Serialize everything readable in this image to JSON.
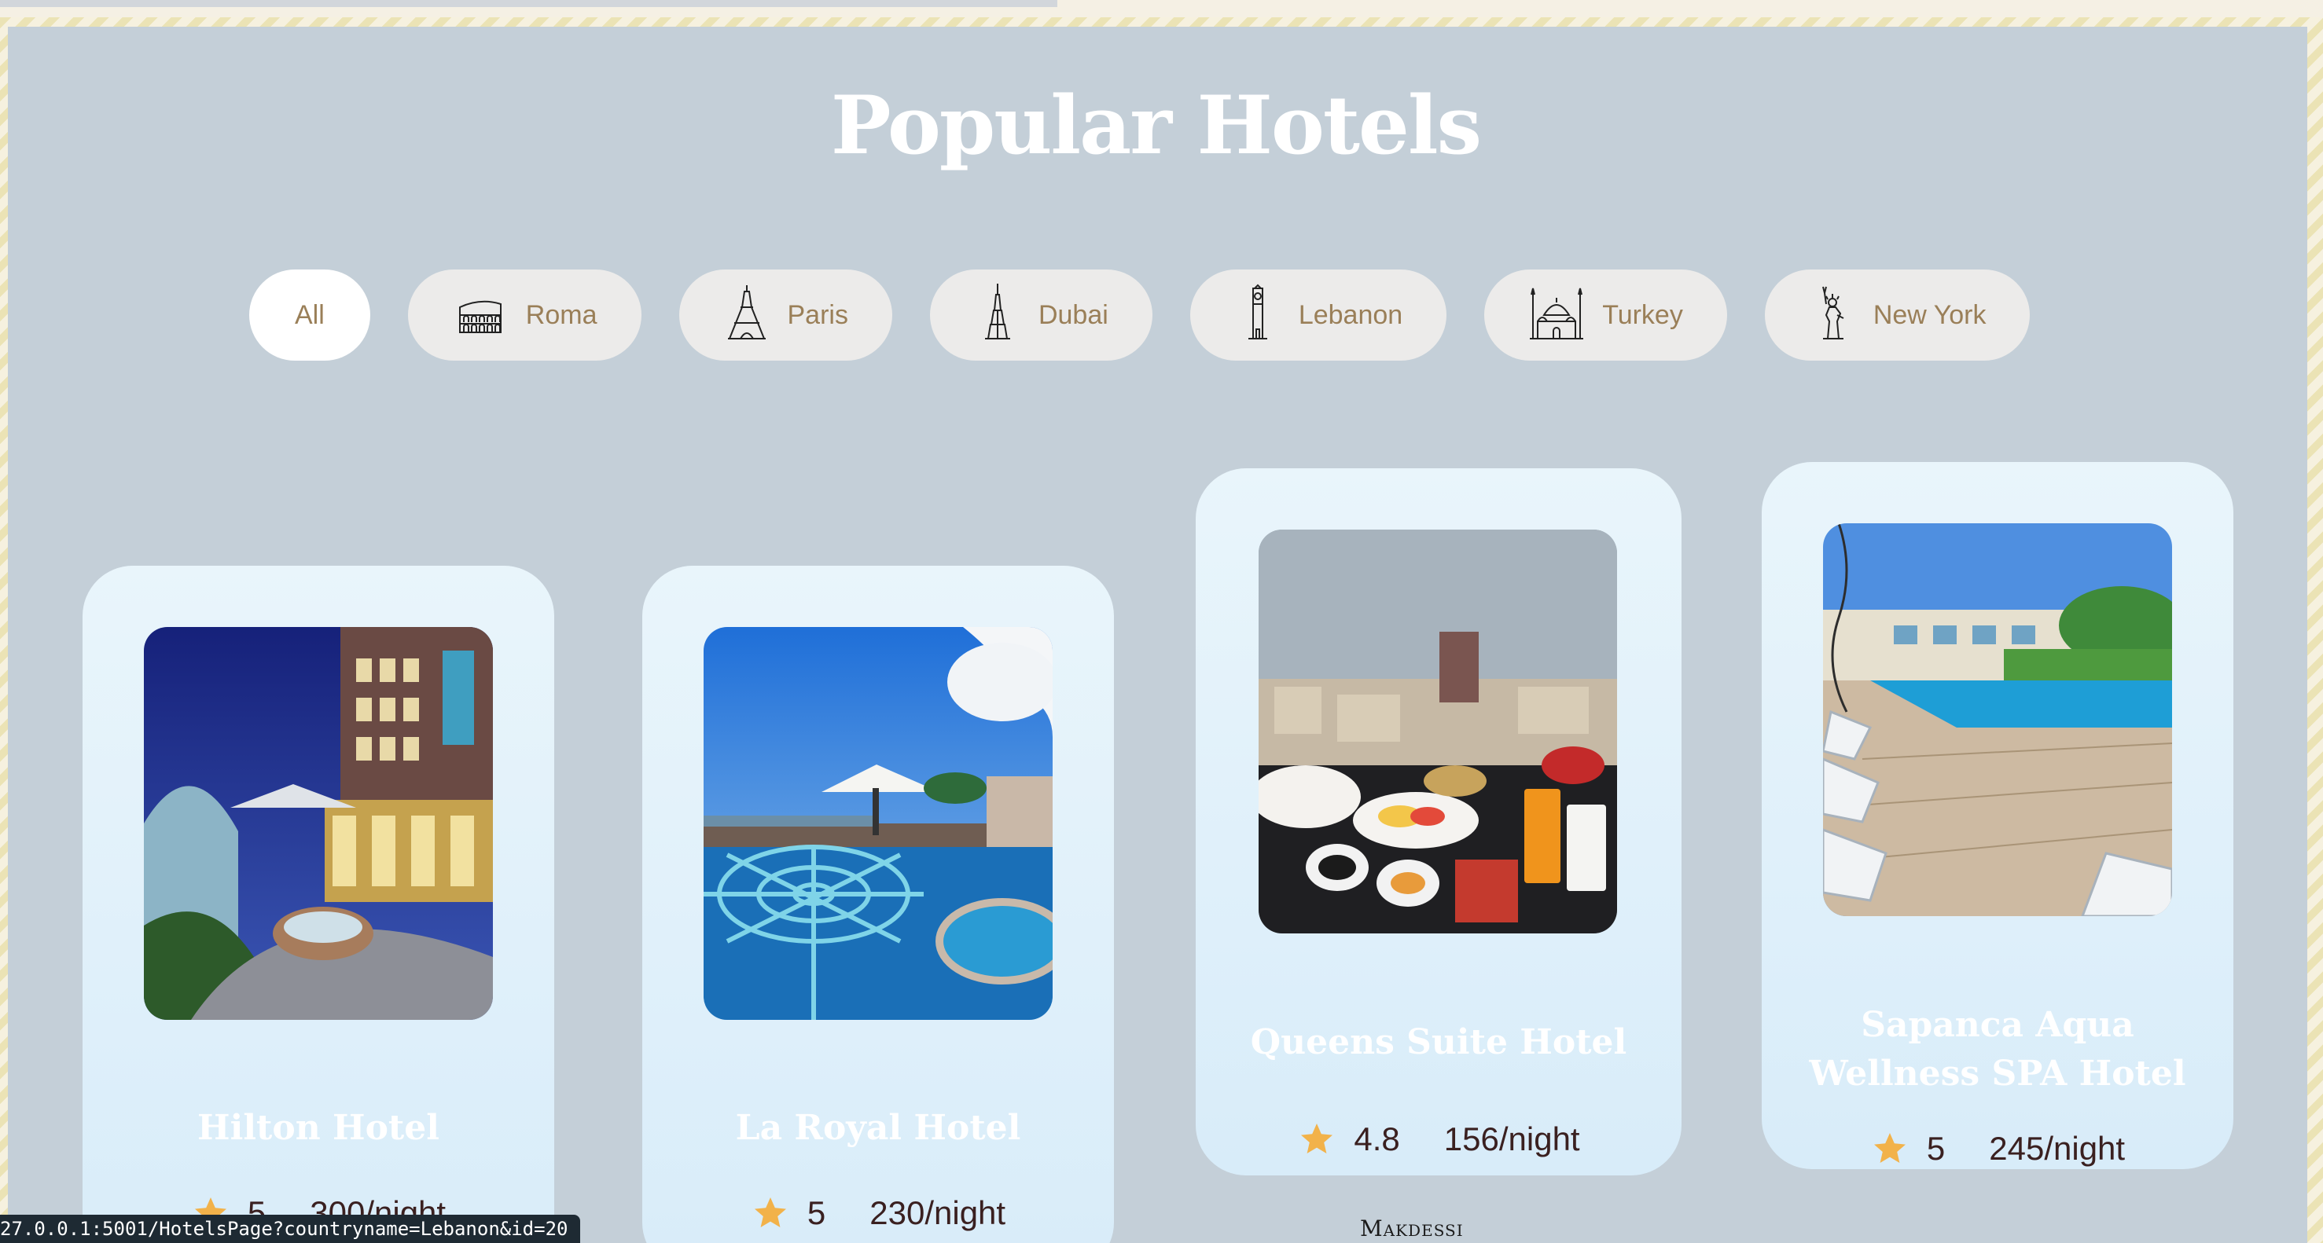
{
  "page": {
    "title": "Popular Hotels"
  },
  "filters": [
    {
      "label": "All",
      "icon": "none",
      "active": true
    },
    {
      "label": "Roma",
      "icon": "colosseum-icon",
      "active": false
    },
    {
      "label": "Paris",
      "icon": "eiffel-tower-icon",
      "active": false
    },
    {
      "label": "Dubai",
      "icon": "burj-khalifa-icon",
      "active": false
    },
    {
      "label": "Lebanon",
      "icon": "clock-tower-icon",
      "active": false
    },
    {
      "label": "Turkey",
      "icon": "mosque-icon",
      "active": false
    },
    {
      "label": "New York",
      "icon": "statue-of-liberty-icon",
      "active": false
    }
  ],
  "hotels": [
    {
      "name": "Hilton Hotel",
      "rating": "5",
      "price": "300/night"
    },
    {
      "name": "La Royal Hotel",
      "rating": "5",
      "price": "230/night"
    },
    {
      "name": "Queens Suite Hotel",
      "rating": "4.8",
      "price": "156/night",
      "logo_text": "Makdessi"
    },
    {
      "name": "Sapanca Aqua Wellness SPA Hotel",
      "rating": "5",
      "price": "245/night"
    }
  ],
  "status_bar": {
    "url": "27.0.0.1:5001/HotelsPage?countryname=Lebanon&id=20"
  },
  "colors": {
    "panel": "#c4cfd8",
    "pill_text": "#9a7f58",
    "star": "#f2b24a"
  }
}
